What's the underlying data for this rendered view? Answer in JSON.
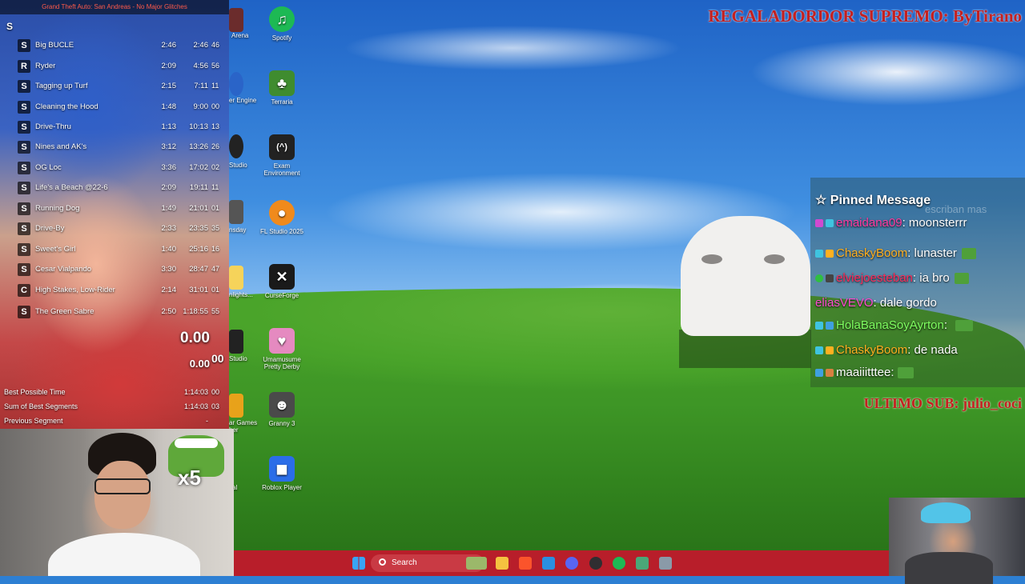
{
  "overlay": {
    "title_banner": "REGALADORDOR SUPREMO: ByTirano",
    "sub_banner": "ULTIMO SUB: julio_coci"
  },
  "splits": {
    "game_title": "Grand Theft Auto: San Andreas - No Major Glitches",
    "top_icon": "S",
    "rows": [
      {
        "icon": "S",
        "name": "Big BUCLE",
        "segment": "2:46",
        "total": "2:46",
        "edge": "46"
      },
      {
        "icon": "R",
        "name": "Ryder",
        "segment": "2:09",
        "total": "4:56",
        "edge": "56"
      },
      {
        "icon": "S",
        "name": "Tagging up Turf",
        "segment": "2:15",
        "total": "7:11",
        "edge": "11"
      },
      {
        "icon": "S",
        "name": "Cleaning the Hood",
        "segment": "1:48",
        "total": "9:00",
        "edge": "00"
      },
      {
        "icon": "S",
        "name": "Drive-Thru",
        "segment": "1:13",
        "total": "10:13",
        "edge": "13"
      },
      {
        "icon": "S",
        "name": "Nines and AK's",
        "segment": "3:12",
        "total": "13:26",
        "edge": "26"
      },
      {
        "icon": "S",
        "name": "OG Loc",
        "segment": "3:36",
        "total": "17:02",
        "edge": "02"
      },
      {
        "icon": "S",
        "name": "Life's a Beach @22-6",
        "segment": "2:09",
        "total": "19:11",
        "edge": "11"
      },
      {
        "icon": "S",
        "name": "Running Dog",
        "segment": "1:49",
        "total": "21:01",
        "edge": "01"
      },
      {
        "icon": "S",
        "name": "Drive-By",
        "segment": "2:33",
        "total": "23:35",
        "edge": "35"
      },
      {
        "icon": "S",
        "name": "Sweet's Girl",
        "segment": "1:40",
        "total": "25:16",
        "edge": "16"
      },
      {
        "icon": "S",
        "name": "Cesar Vialpando",
        "segment": "3:30",
        "total": "28:47",
        "edge": "47"
      },
      {
        "icon": "C",
        "name": "High Stakes, Low-Rider",
        "segment": "2:14",
        "total": "31:01",
        "edge": "01"
      },
      {
        "icon": "S",
        "name": "The Green Sabre",
        "segment": "2:50",
        "total": "1:18:55",
        "edge": "55"
      }
    ],
    "timer_main": "0.00",
    "timer_segment": "0.00",
    "timer_edge": "00",
    "best_possible_label": "Best Possible Time",
    "best_possible_value": "1:14:03",
    "best_possible_edge": "00",
    "sum_best_label": "Sum of Best Segments",
    "sum_best_value": "1:14:03",
    "sum_best_edge": "03",
    "previous_segment_label": "Previous Segment",
    "previous_segment_value": "-"
  },
  "desktop": {
    "icons": [
      {
        "label": "Spotify",
        "color": "#1db954",
        "glyph": "♫"
      },
      {
        "label": "Terraria",
        "color": "#3f8c2f",
        "glyph": "♣"
      },
      {
        "label": "Exam Environment",
        "color": "#222222",
        "glyph": "(^)"
      },
      {
        "label": "FL Studio 2025",
        "color": "#f08a1c",
        "glyph": "●"
      },
      {
        "label": "CurseForge",
        "color": "#1a1a1a",
        "glyph": "✕"
      },
      {
        "label": "Umamusume Pretty Derby",
        "color": "#e58ac0",
        "glyph": "♥"
      },
      {
        "label": "Granny 3",
        "color": "#4a4a4a",
        "glyph": "☻"
      },
      {
        "label": "Roblox Player",
        "color": "#2b6de8",
        "glyph": "◼"
      }
    ],
    "partial_labels": [
      "Arena",
      "er Engine",
      "Studio",
      "nsday",
      "nlights...",
      "Studio",
      "ar Games\nher",
      "al"
    ]
  },
  "chat": {
    "pinned_label": "Pinned Message",
    "pinned_behind": "escriban mas",
    "lines": [
      {
        "user": "emaidana09",
        "user_color": "#ff3aa0",
        "msg": "moonsterrr"
      },
      {
        "user": "ChaskyBoom",
        "user_color": "#ffb020",
        "msg": "lunaster"
      },
      {
        "user": "elviejoesteban",
        "user_color": "#ff2a5a",
        "msg": "ia bro"
      },
      {
        "user": "eliasVEVO",
        "user_color": "#ff4ad0",
        "msg": "dale gordo"
      },
      {
        "user": "HolaBanaSoyAyrton",
        "user_color": "#7fff60",
        "msg": ""
      },
      {
        "user": "ChaskyBoom",
        "user_color": "#ffb020",
        "msg": "de nada"
      },
      {
        "user": "maaiiitttee",
        "user_color": "#ffffff",
        "msg": ""
      }
    ]
  },
  "webcam": {
    "emote_multiplier": "x5"
  },
  "taskbar": {
    "search_placeholder": "Search",
    "icons": [
      "windows-icon",
      "file-explorer-icon",
      "brave-icon",
      "vscode-icon",
      "discord-icon",
      "obs-icon",
      "spotify-icon",
      "app-icon",
      "app-icon-2"
    ]
  },
  "colors": {
    "accent_red": "#c42020",
    "taskbar": "#b81e2a"
  }
}
